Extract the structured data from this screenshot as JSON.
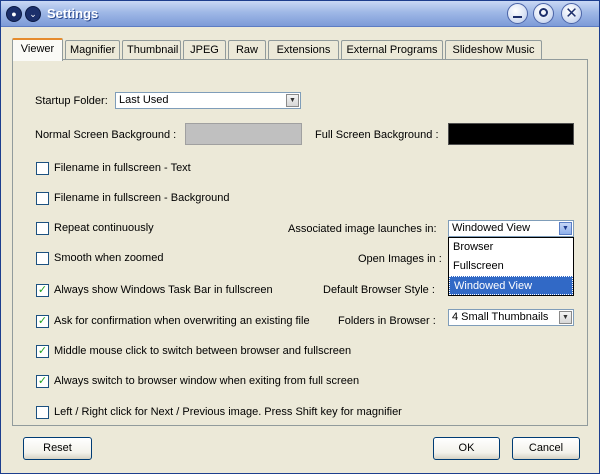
{
  "window": {
    "title": "Settings"
  },
  "tabs": [
    {
      "label": "Viewer"
    },
    {
      "label": "Magnifier"
    },
    {
      "label": "Thumbnail"
    },
    {
      "label": "JPEG"
    },
    {
      "label": "Raw"
    },
    {
      "label": "Extensions"
    },
    {
      "label": "External Programs"
    },
    {
      "label": "Slideshow Music"
    }
  ],
  "viewer": {
    "startup_folder": {
      "label": "Startup Folder:",
      "value": "Last Used"
    },
    "normal_bg": {
      "label": "Normal Screen Background :",
      "color": "#c0c0c0"
    },
    "full_bg": {
      "label": "Full Screen Background :",
      "color": "#000000"
    },
    "checkboxes": [
      {
        "label": "Filename in fullscreen - Text",
        "checked": false
      },
      {
        "label": "Filename in fullscreen - Background",
        "checked": false
      },
      {
        "label": "Repeat continuously",
        "checked": false
      },
      {
        "label": "Smooth when zoomed",
        "checked": false
      },
      {
        "label": "Always show Windows Task Bar in fullscreen",
        "checked": true
      },
      {
        "label": "Ask for confirmation when overwriting an existing file",
        "checked": true
      },
      {
        "label": "Middle mouse click to switch between browser and fullscreen",
        "checked": true
      },
      {
        "label": "Always switch to browser window when exiting from full screen",
        "checked": true
      },
      {
        "label": "Left / Right click for Next / Previous image. Press Shift key for magnifier",
        "checked": false
      }
    ],
    "associated_launch": {
      "label": "Associated image launches in:",
      "value": "Windowed View",
      "options": [
        "Browser",
        "Fullscreen",
        "Windowed View"
      ],
      "selected": "Windowed View"
    },
    "open_images": {
      "label": "Open Images in :"
    },
    "default_browser_style": {
      "label": "Default Browser Style :"
    },
    "folders_in_browser": {
      "label": "Folders in Browser :",
      "value": "4 Small Thumbnails"
    }
  },
  "buttons": {
    "reset": "Reset",
    "ok": "OK",
    "cancel": "Cancel"
  },
  "icons": {
    "app": "circle-icon",
    "menu": "chevron-down-icon",
    "minimize": "minimize-icon",
    "maximize": "maximize-icon",
    "close": "close-icon"
  }
}
